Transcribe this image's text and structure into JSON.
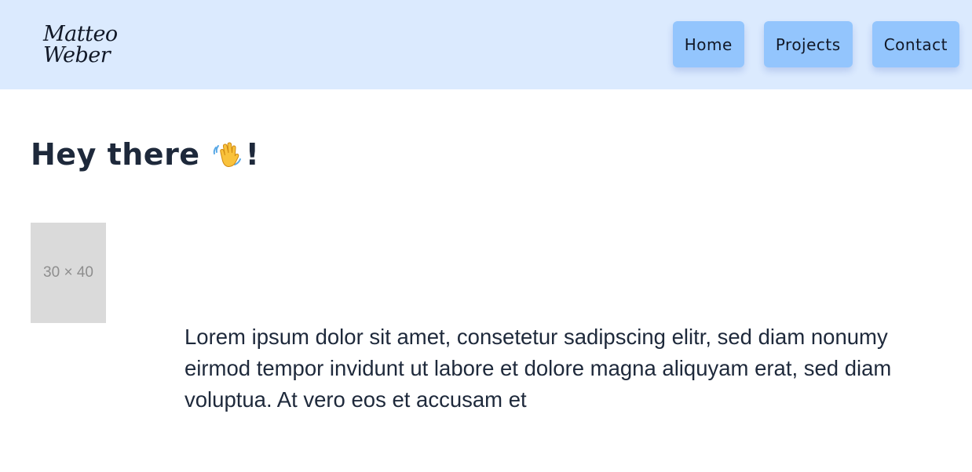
{
  "header": {
    "logo_line1": "Matteo",
    "logo_line2": "Weber",
    "nav": [
      "Home",
      "Projects",
      "Contact"
    ]
  },
  "main": {
    "greeting": "Hey there",
    "greeting_suffix": "!",
    "greeting_icon": "waving-hand-icon",
    "image_placeholder": "30 × 40",
    "paragraph": "Lorem ipsum dolor sit amet, consetetur sadipscing elitr, sed diam nonumy eirmod tempor invidunt ut labore et dolore magna aliquyam erat, sed diam voluptua. At vero eos et accusam et"
  },
  "colors": {
    "header_bg": "#dbeafe",
    "nav_button_bg": "#93c5fd",
    "text": "#1e293b",
    "placeholder_bg": "#dadada"
  }
}
